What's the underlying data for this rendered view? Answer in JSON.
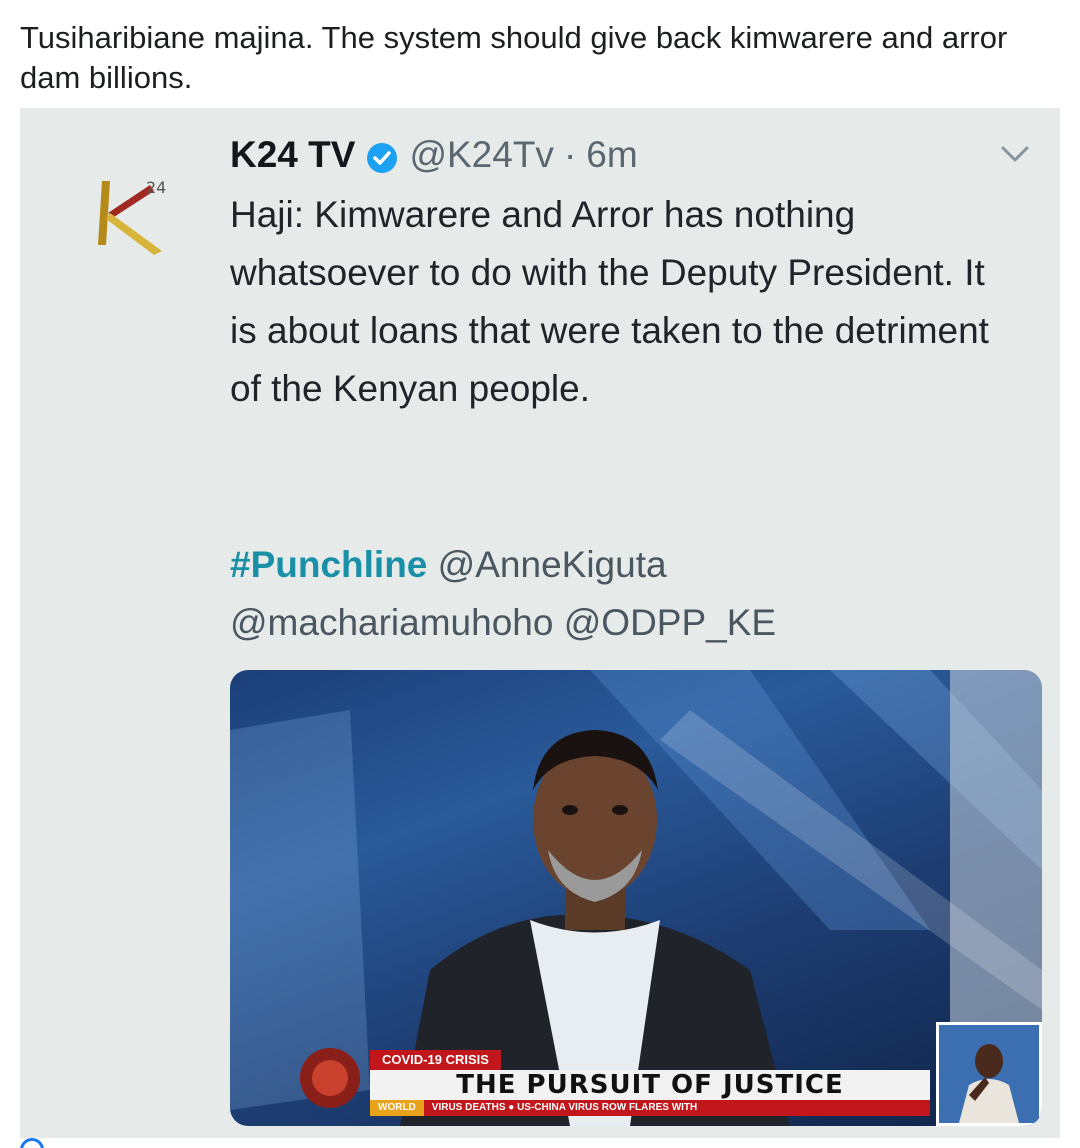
{
  "post": {
    "caption": "Tusiharibiane majina. The system should give back kimwarere and arror dam billions."
  },
  "tweet": {
    "display_name": "K24 TV",
    "handle": "@K24Tv",
    "separator": "·",
    "time": "6m",
    "text": "Haji: Kimwarere and Arror has nothing whatsoever to do with the Deputy President. It is about loans that were taken to the detriment of the Kenyan people.",
    "hashtag": "#Punchline",
    "mentions": [
      "@AnneKiguta",
      "@machariamuhoho",
      "@ODPP_KE"
    ]
  },
  "media": {
    "lower_third_tag": "COVID-19 CRISIS",
    "lower_third_title": "THE PURSUIT OF JUSTICE",
    "ticker_label": "WORLD",
    "ticker_text": "VIRUS DEATHS  ●  US-CHINA VIRUS ROW FLARES WITH"
  },
  "icons": {
    "avatar": "k24-logo-icon",
    "verified": "verified-badge-icon",
    "menu": "chevron-down-icon"
  },
  "colors": {
    "hashtag": "#1a8fa8",
    "verified": "#1da1f2",
    "accent_red": "#c0161c"
  }
}
